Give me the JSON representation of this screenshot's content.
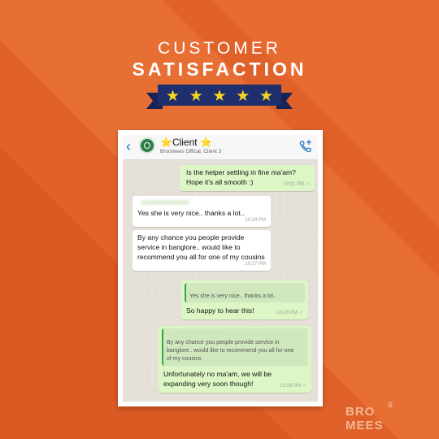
{
  "header": {
    "line1": "CUSTOMER",
    "line2": "SATISFACTION",
    "stars": [
      "★",
      "★",
      "★",
      "★",
      "★"
    ]
  },
  "chat": {
    "contact_name": "⭐Client ⭐",
    "contact_subtitle": "Broomees Offical, Client 3",
    "back_icon": "‹",
    "messages": [
      {
        "lines": [
          "Is the helper settling in fine ma'am?",
          "Hope it's all smooth :)"
        ],
        "time": "10:01 PM",
        "ticks": "✓"
      },
      {
        "lines": [
          "Yes she is very nice.. thanks a lot.."
        ],
        "time": "10:24 PM"
      },
      {
        "lines": [
          "By any chance you people provide",
          "service in banglore.. would like to",
          "recommend you all for one of my cousins"
        ],
        "time": "10:27 PM"
      },
      {
        "quote": [
          "Yes she is very nice.. thanks a lot.."
        ],
        "lines": [
          "So happy to hear this!"
        ],
        "time": "10:28 PM",
        "ticks": "✓"
      },
      {
        "quote": [
          "By any chance you people provide service in",
          "banglore.. would like to recommend you all for one",
          "of my cousins"
        ],
        "lines": [
          "Unfortunately no ma'am, we will be",
          "expanding very soon though!"
        ],
        "time": "10:28 PM",
        "ticks": "✓"
      }
    ]
  },
  "brand": {
    "logo_left": "BRO",
    "logo_right": "MEES",
    "logo_mark": "S"
  },
  "colors": {
    "background": "#e0612a",
    "ribbon": "#1f2f6e",
    "star": "#f6d31f",
    "outgoing_bubble": "#dcf7c5",
    "incoming_bubble": "#ffffff"
  }
}
